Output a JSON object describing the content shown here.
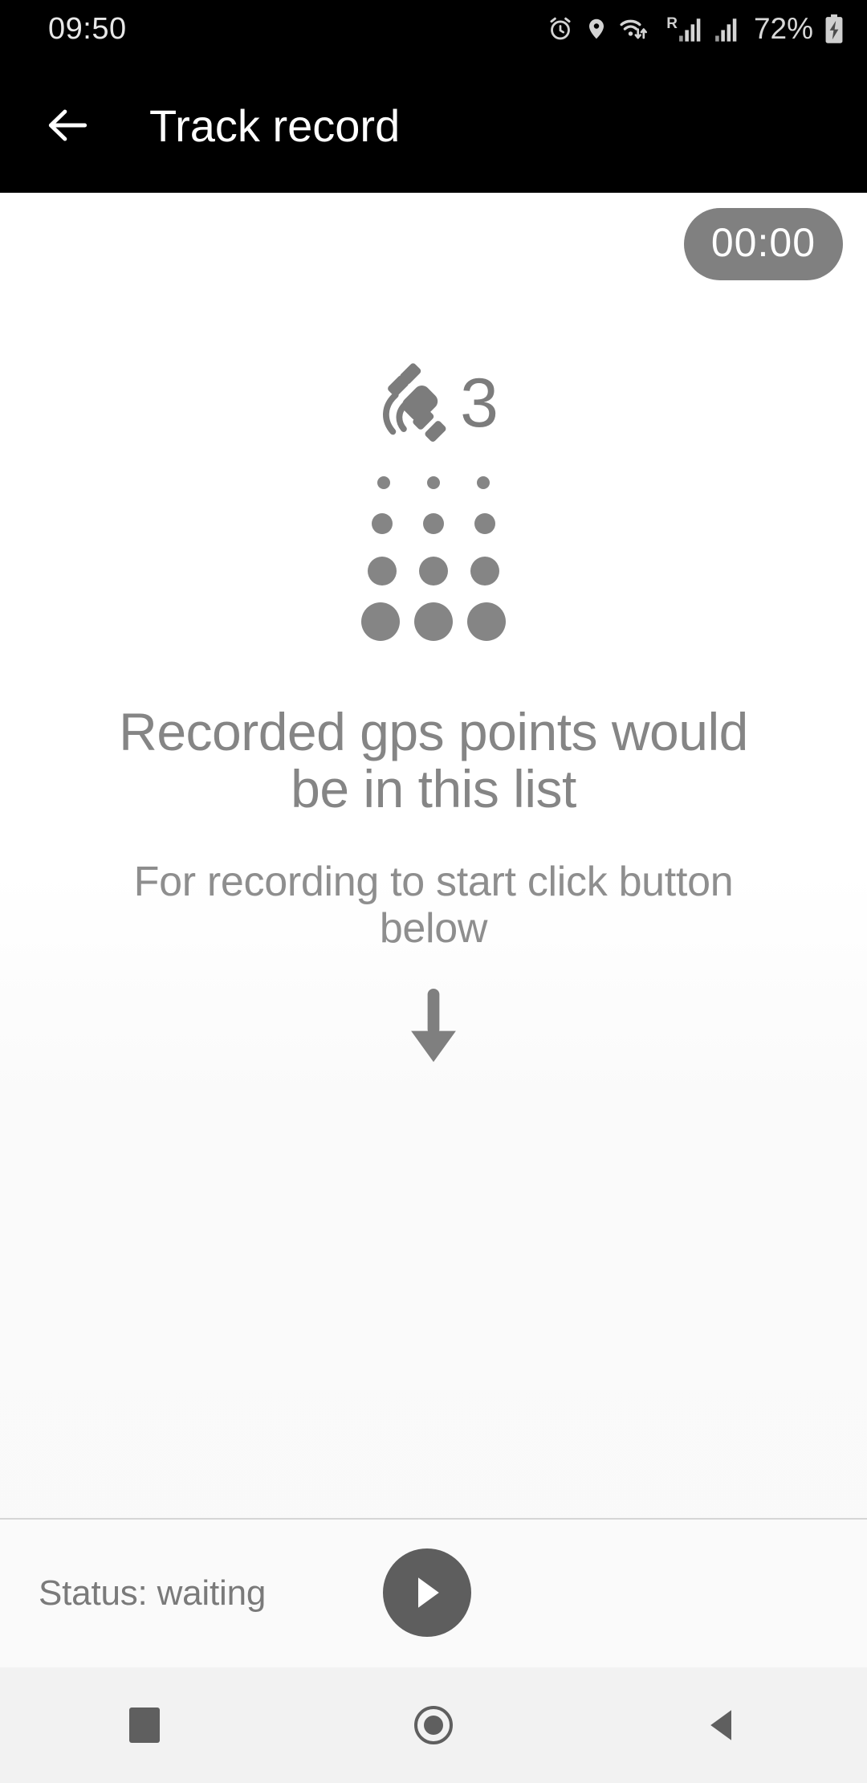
{
  "statusbar": {
    "time": "09:50",
    "battery_percent": "72%",
    "roaming_label": "R",
    "icons": [
      "alarm-icon",
      "location-icon",
      "wifi-icon",
      "roaming-signal-icon",
      "signal-icon",
      "battery-charging-icon"
    ]
  },
  "appbar": {
    "title": "Track record",
    "back_icon": "arrow-left-icon"
  },
  "timer": {
    "value": "00:00"
  },
  "empty_state": {
    "satellite_icon": "satellite-icon",
    "satellite_count": "3",
    "title": "Recorded gps points would be in this list",
    "subtitle": "For recording to start click button below",
    "arrow_icon": "arrow-down-icon",
    "dot_rows": [
      {
        "size": 16,
        "count": 3
      },
      {
        "size": 26,
        "count": 3
      },
      {
        "size": 36,
        "count": 3
      },
      {
        "size": 48,
        "count": 3
      }
    ]
  },
  "control_bar": {
    "status_label": "Status: waiting",
    "play_icon": "play-icon"
  },
  "navbar": {
    "recents_label": "recents-icon",
    "home_label": "home-icon",
    "back_label": "back-icon"
  },
  "colors": {
    "appbar_bg": "#000000",
    "chip_bg": "#808080",
    "muted_text": "#858585",
    "fab_bg": "#5e5e5e",
    "nav_bg": "#f2f2f2"
  }
}
